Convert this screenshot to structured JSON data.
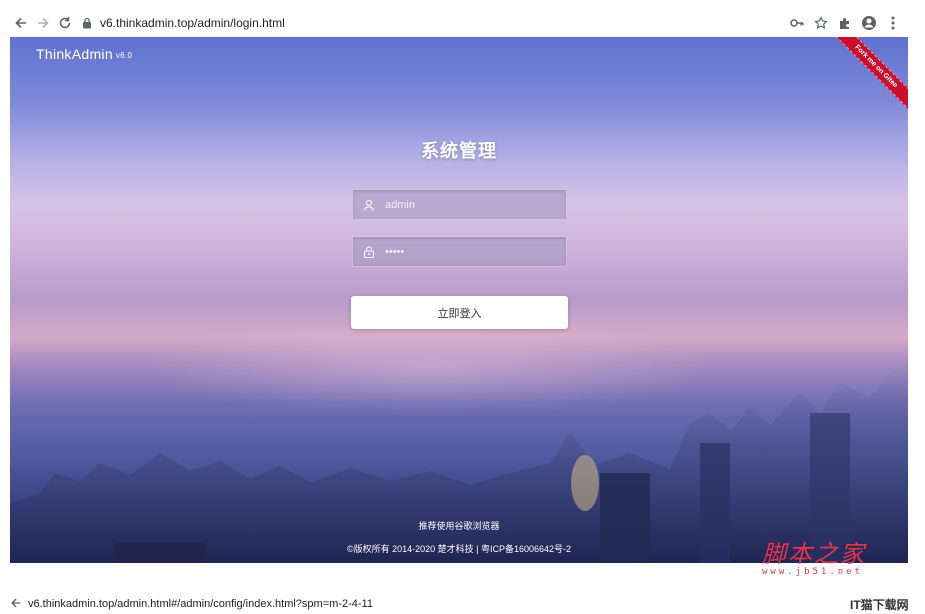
{
  "browser": {
    "url": "v6.thinkadmin.top/admin/login.html",
    "icons": [
      "back-arrow-icon",
      "forward-arrow-icon",
      "reload-icon",
      "lock-icon",
      "key-icon",
      "star-icon",
      "puzzle-icon",
      "profile-icon",
      "menu-dots-icon"
    ]
  },
  "page": {
    "brand": "ThinkAdmin",
    "version": "v6.0",
    "ribbon": "Fork me on Gitee",
    "title": "系统管理",
    "username_value": "admin",
    "password_value": "•••••",
    "login_label": "立即登入",
    "recommend": "推荐使用谷歌浏览器",
    "copyright": "©版权所有 2014-2020 楚才科技 | 粤ICP备16006642号-2"
  },
  "watermark": {
    "main": "脚本之家",
    "sub": "www.jb51.net"
  },
  "bottom_bar": {
    "url": "v6.thinkadmin.top/admin.html#/admin/config/index.html?spm=m-2-4-11",
    "corner": "IT猫下载网"
  },
  "colors": {
    "ribbon": "#c8102e",
    "watermark": "#e7344b",
    "sky_top": "#5f72cf",
    "city_bottom": "#252c5d"
  }
}
